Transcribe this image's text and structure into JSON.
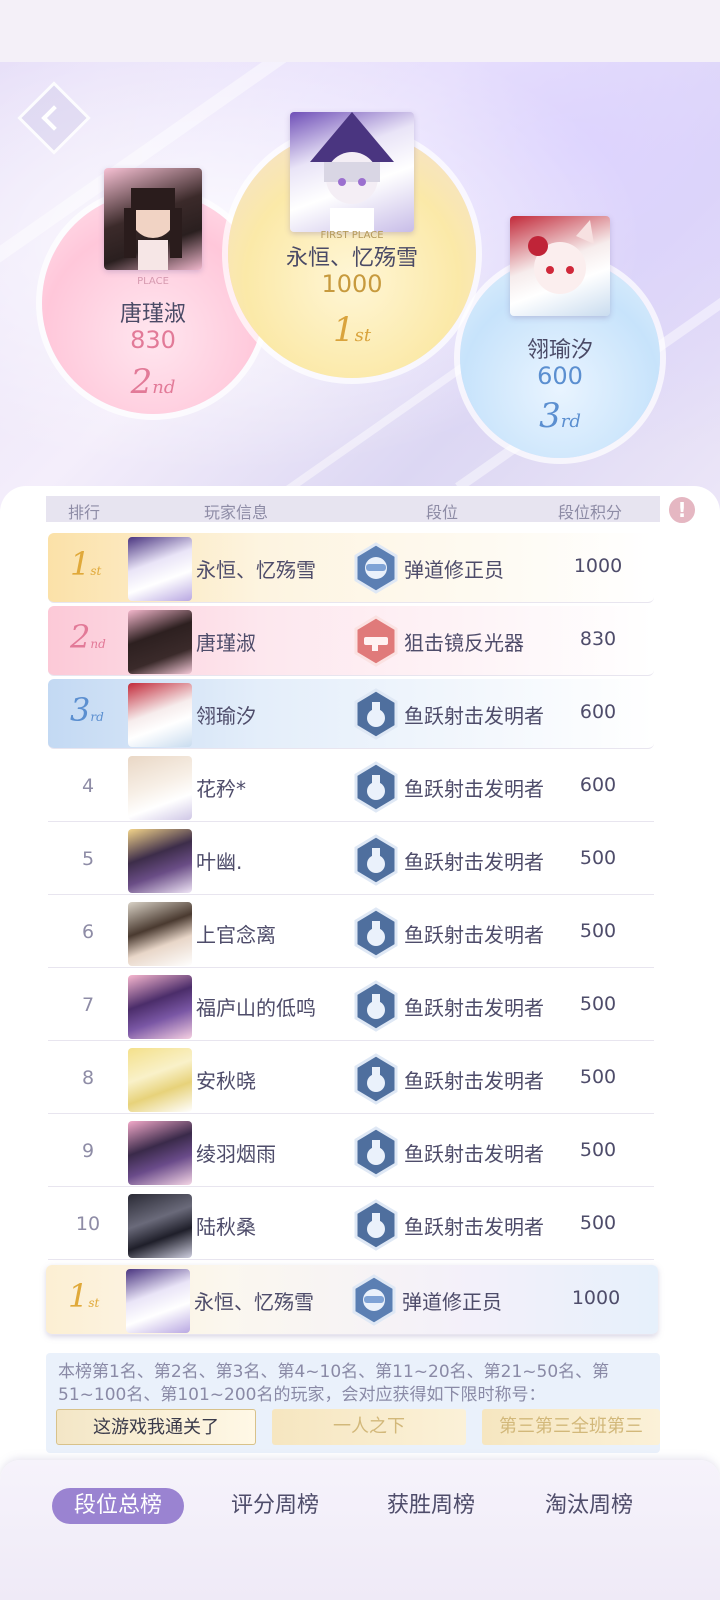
{
  "podium": [
    {
      "rank_label": "1",
      "rank_suffix": "st",
      "place_text": "FIRST PLACE",
      "name": "永恒、忆殇雪",
      "score": "1000"
    },
    {
      "rank_label": "2",
      "rank_suffix": "nd",
      "place_text": "PLACE",
      "name": "唐瑾淑",
      "score": "830"
    },
    {
      "rank_label": "3",
      "rank_suffix": "rd",
      "place_text": "",
      "name": "翎瑜汐",
      "score": "600"
    }
  ],
  "table": {
    "headers": {
      "rank": "排行",
      "player": "玩家信息",
      "tier": "段位",
      "points": "段位积分"
    },
    "info_icon": "!",
    "rows": [
      {
        "rank": "1",
        "suffix": "st",
        "name": "永恒、忆殇雪",
        "tier": "弹道修正员",
        "score": "1000"
      },
      {
        "rank": "2",
        "suffix": "nd",
        "name": "唐瑾淑",
        "tier": "狙击镜反光器",
        "score": "830"
      },
      {
        "rank": "3",
        "suffix": "rd",
        "name": "翎瑜汐",
        "tier": "鱼跃射击发明者",
        "score": "600"
      },
      {
        "rank": "4",
        "name": "花矜*",
        "tier": "鱼跃射击发明者",
        "score": "600"
      },
      {
        "rank": "5",
        "name": "叶幽.",
        "tier": "鱼跃射击发明者",
        "score": "500"
      },
      {
        "rank": "6",
        "name": "上官念离",
        "tier": "鱼跃射击发明者",
        "score": "500"
      },
      {
        "rank": "7",
        "name": "福庐山的低鸣",
        "tier": "鱼跃射击发明者",
        "score": "500"
      },
      {
        "rank": "8",
        "name": "安秋晓",
        "tier": "鱼跃射击发明者",
        "score": "500"
      },
      {
        "rank": "9",
        "name": "绫羽烟雨",
        "tier": "鱼跃射击发明者",
        "score": "500"
      },
      {
        "rank": "10",
        "name": "陆秋桑",
        "tier": "鱼跃射击发明者",
        "score": "500"
      }
    ],
    "self_row": {
      "rank": "1",
      "suffix": "st",
      "name": "永恒、忆殇雪",
      "tier": "弹道修正员",
      "score": "1000"
    }
  },
  "notice": {
    "text": "本榜第1名、第2名、第3名、第4~10名、第11~20名、第21~50名、第51~100名、第101~200名的玩家，会对应获得如下限时称号：",
    "titles": [
      "这游戏我通关了",
      "一人之下",
      "第三第三全班第三"
    ]
  },
  "tabs": [
    "段位总榜",
    "评分周榜",
    "获胜周榜",
    "淘汰周榜"
  ],
  "colors": {
    "accent": "#9a83d1",
    "gold": "#e0a93a",
    "pink": "#e27a98",
    "blue": "#5b8fd0"
  }
}
